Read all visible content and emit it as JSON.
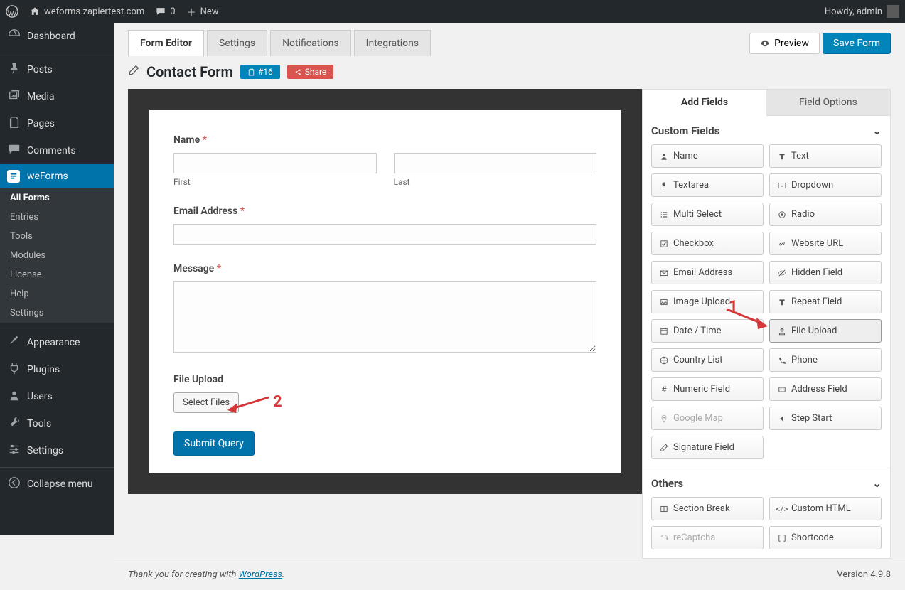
{
  "adminbar": {
    "site": "weforms.zapiertest.com",
    "comments": "0",
    "new": "New",
    "howdy": "Howdy, admin"
  },
  "sidebar": {
    "dashboard": "Dashboard",
    "posts": "Posts",
    "media": "Media",
    "pages": "Pages",
    "comments": "Comments",
    "weforms": "weForms",
    "sub": {
      "allforms": "All Forms",
      "entries": "Entries",
      "tools": "Tools",
      "modules": "Modules",
      "license": "License",
      "help": "Help",
      "settings": "Settings"
    },
    "appearance": "Appearance",
    "plugins": "Plugins",
    "users": "Users",
    "tools": "Tools",
    "settings": "Settings",
    "collapse": "Collapse menu"
  },
  "tabs": {
    "editor": "Form Editor",
    "settings": "Settings",
    "notifications": "Notifications",
    "integrations": "Integrations"
  },
  "actions": {
    "preview": "Preview",
    "save": "Save Form"
  },
  "form": {
    "title": "Contact Form",
    "id_badge": "#16",
    "share": "Share",
    "fields": {
      "name": {
        "label": "Name",
        "first": "First",
        "last": "Last"
      },
      "email": {
        "label": "Email Address"
      },
      "message": {
        "label": "Message"
      },
      "file": {
        "label": "File Upload",
        "button": "Select Files"
      },
      "submit": "Submit Query"
    }
  },
  "panel": {
    "tabs": {
      "add": "Add Fields",
      "options": "Field Options"
    },
    "section_custom": "Custom Fields",
    "section_others": "Others",
    "custom": [
      {
        "label": "Name",
        "icon": "user-icon"
      },
      {
        "label": "Text",
        "icon": "text-icon"
      },
      {
        "label": "Textarea",
        "icon": "para-icon"
      },
      {
        "label": "Dropdown",
        "icon": "caret-down-icon"
      },
      {
        "label": "Multi Select",
        "icon": "list-icon"
      },
      {
        "label": "Radio",
        "icon": "radio-icon"
      },
      {
        "label": "Checkbox",
        "icon": "check-icon"
      },
      {
        "label": "Website URL",
        "icon": "link-icon"
      },
      {
        "label": "Email Address",
        "icon": "mail-icon"
      },
      {
        "label": "Hidden Field",
        "icon": "eye-slash-icon"
      },
      {
        "label": "Image Upload",
        "icon": "image-icon"
      },
      {
        "label": "Repeat Field",
        "icon": "repeat-icon"
      },
      {
        "label": "Date / Time",
        "icon": "calendar-icon"
      },
      {
        "label": "File Upload",
        "icon": "upload-icon",
        "highlight": true
      },
      {
        "label": "Country List",
        "icon": "globe-icon"
      },
      {
        "label": "Phone",
        "icon": "phone-icon"
      },
      {
        "label": "Numeric Field",
        "icon": "hash-icon"
      },
      {
        "label": "Address Field",
        "icon": "address-icon"
      },
      {
        "label": "Google Map",
        "icon": "pin-icon",
        "disabled": true
      },
      {
        "label": "Step Start",
        "icon": "step-icon"
      },
      {
        "label": "Signature Field",
        "icon": "pen-icon"
      }
    ],
    "others": [
      {
        "label": "Section Break",
        "icon": "columns-icon"
      },
      {
        "label": "Custom HTML",
        "icon": "code-icon"
      },
      {
        "label": "reCaptcha",
        "icon": "recaptcha-icon",
        "disabled": true
      },
      {
        "label": "Shortcode",
        "icon": "shortcode-icon"
      }
    ]
  },
  "footer": {
    "text_pre": "Thank you for creating with ",
    "link": "WordPress",
    "text_post": ".",
    "version": "Version 4.9.8"
  },
  "annotations": {
    "a1": "1",
    "a2": "2"
  }
}
